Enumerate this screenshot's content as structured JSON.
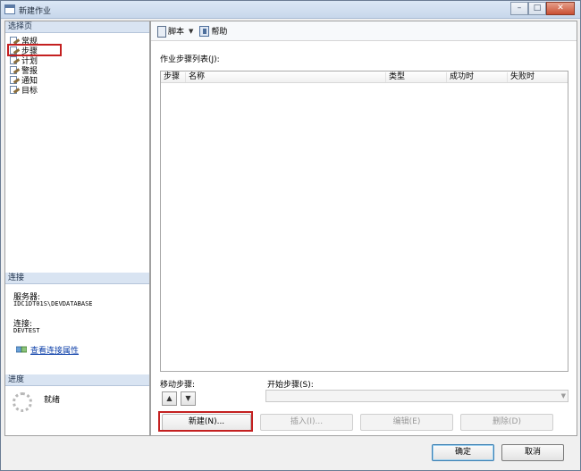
{
  "window": {
    "title": "新建作业"
  },
  "select_page": {
    "header": "选择页",
    "items": [
      {
        "label": "常规",
        "selected": false
      },
      {
        "label": "步骤",
        "selected": true
      },
      {
        "label": "计划",
        "selected": false
      },
      {
        "label": "警报",
        "selected": false
      },
      {
        "label": "通知",
        "selected": false
      },
      {
        "label": "目标",
        "selected": false
      }
    ]
  },
  "connection": {
    "header": "连接",
    "server_label": "服务器:",
    "server_value": "IDC1DT01S\\DEVDATABASE",
    "connection_label": "连接:",
    "connection_value": "DEVTEST",
    "view_link": "查看连接属性"
  },
  "progress": {
    "header": "进度",
    "status": "就绪"
  },
  "toolbar": {
    "script_label": "脚本",
    "help_label": "帮助"
  },
  "steps": {
    "list_label": "作业步骤列表(J):",
    "columns": [
      "步骤",
      "名称",
      "类型",
      "成功时",
      "失败时"
    ],
    "rows": []
  },
  "move": {
    "label": "移动步骤:",
    "up_symbol": "▲",
    "down_symbol": "▼"
  },
  "start_step": {
    "label": "开始步骤(S):",
    "value": ""
  },
  "actions": {
    "new": "新建(N)...",
    "insert": "插入(I)...",
    "edit": "编辑(E)",
    "delete": "删除(D)"
  },
  "dialog": {
    "ok": "确定",
    "cancel": "取消"
  },
  "colors": {
    "highlight": "#c42020",
    "link": "#0b3ea8",
    "section_header": "#d9e4f2"
  }
}
